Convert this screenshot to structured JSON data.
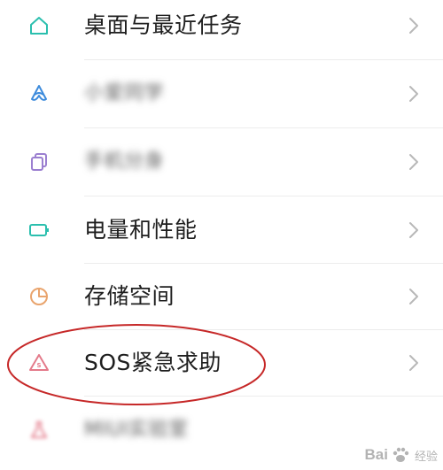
{
  "settings_list": {
    "items": [
      {
        "label": "桌面与最近任务",
        "icon": "home-icon"
      },
      {
        "label": "小爱同学",
        "icon": "xiaoai-assistant-icon"
      },
      {
        "label": "手机分身",
        "icon": "phone-clone-icon"
      },
      {
        "label": "电量和性能",
        "icon": "battery-icon"
      },
      {
        "label": "存储空间",
        "icon": "storage-pie-icon"
      },
      {
        "label": "SOS紧急求助",
        "icon": "sos-alert-icon"
      },
      {
        "label": "MIUI实验室",
        "icon": "miui-lab-icon"
      }
    ]
  },
  "colors": {
    "teal": "#2bbfae",
    "blue": "#3d8bdc",
    "purple": "#9b7fd0",
    "orange": "#e9a46d",
    "pink": "#e47a8a",
    "highlight_red": "#c62828"
  },
  "watermark": {
    "brand": "Bai",
    "brand_suffix": "经验"
  }
}
